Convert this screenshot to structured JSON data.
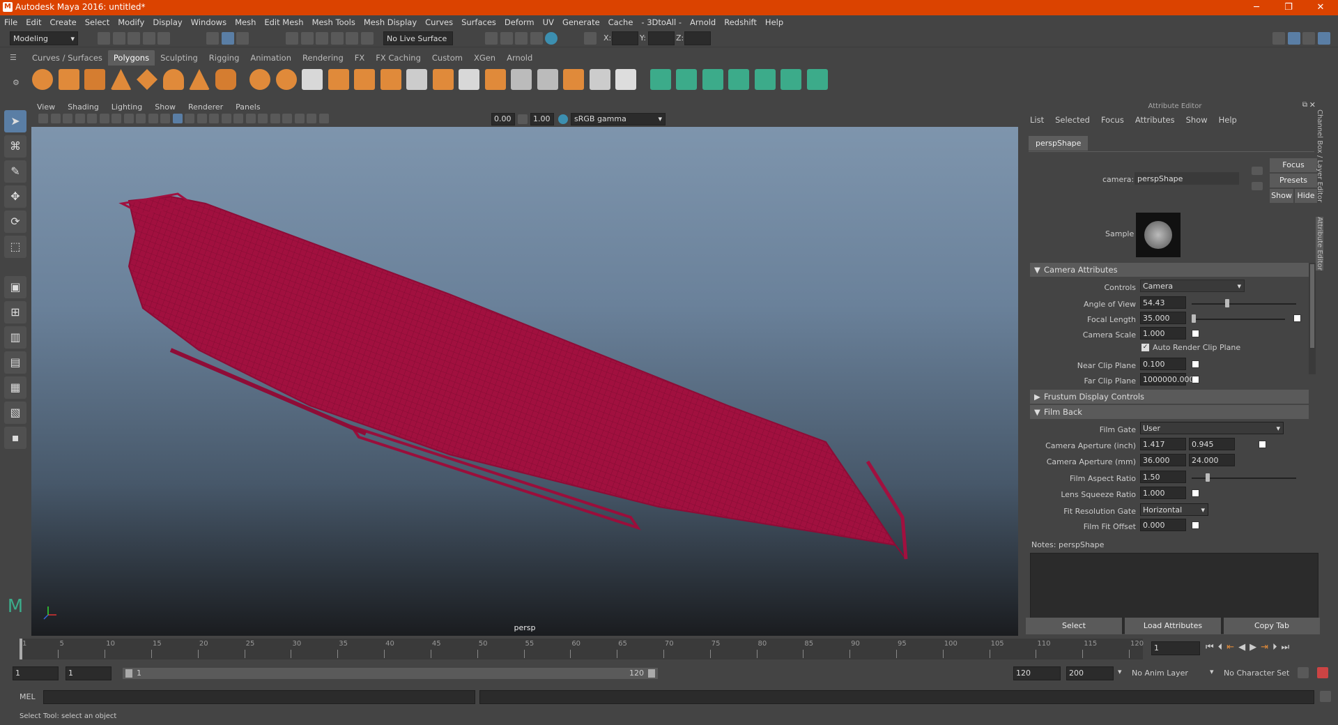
{
  "titlebar": {
    "title": "Autodesk Maya 2016: untitled*",
    "min": "─",
    "max": "❐",
    "close": "✕"
  },
  "menubar": [
    "File",
    "Edit",
    "Create",
    "Select",
    "Modify",
    "Display",
    "Windows",
    "Mesh",
    "Edit Mesh",
    "Mesh Tools",
    "Mesh Display",
    "Curves",
    "Surfaces",
    "Deform",
    "UV",
    "Generate",
    "Cache",
    "- 3DtoAll -",
    "Arnold",
    "Redshift",
    "Help"
  ],
  "statusline": {
    "menuset": "Modeling",
    "live_surface": "No Live Surface",
    "x_label": "X:",
    "y_label": "Y:",
    "z_label": "Z:"
  },
  "shelf_tabs": [
    "Curves / Surfaces",
    "Polygons",
    "Sculpting",
    "Rigging",
    "Animation",
    "Rendering",
    "FX",
    "FX Caching",
    "Custom",
    "XGen",
    "Arnold"
  ],
  "shelf_active": "Polygons",
  "panel_menu": [
    "View",
    "Shading",
    "Lighting",
    "Show",
    "Renderer",
    "Panels"
  ],
  "panel_tools": {
    "near_value": "0.00",
    "far_value": "1.00",
    "color_space": "sRGB gamma"
  },
  "viewport": {
    "camera_label": "persp"
  },
  "attribute_editor": {
    "title": "Attribute Editor",
    "menu": [
      "List",
      "Selected",
      "Focus",
      "Attributes",
      "Show",
      "Help"
    ],
    "tab": "perspShape",
    "camera_label": "camera:",
    "camera_value": "perspShape",
    "focus_btn": "Focus",
    "presets_btn": "Presets",
    "show_btn": "Show",
    "hide_btn": "Hide",
    "sample_label": "Sample",
    "sections": {
      "camera_attributes": "Camera Attributes",
      "frustum": "Frustum Display Controls",
      "film_back": "Film Back"
    },
    "controls_label": "Controls",
    "controls_value": "Camera",
    "angle_label": "Angle of View",
    "angle_value": "54.43",
    "focal_label": "Focal Length",
    "focal_value": "35.000",
    "scale_label": "Camera Scale",
    "scale_value": "1.000",
    "auto_clip_label": "Auto Render Clip Plane",
    "near_label": "Near Clip Plane",
    "near_value": "0.100",
    "far_label": "Far Clip Plane",
    "far_value": "1000000.000",
    "film_gate_label": "Film Gate",
    "film_gate_value": "User",
    "aperture_inch_label": "Camera Aperture (inch)",
    "aperture_inch_x": "1.417",
    "aperture_inch_y": "0.945",
    "aperture_mm_label": "Camera Aperture (mm)",
    "aperture_mm_x": "36.000",
    "aperture_mm_y": "24.000",
    "aspect_label": "Film Aspect Ratio",
    "aspect_value": "1.50",
    "squeeze_label": "Lens Squeeze Ratio",
    "squeeze_value": "1.000",
    "fit_gate_label": "Fit Resolution Gate",
    "fit_gate_value": "Horizontal",
    "fit_offset_label": "Film Fit Offset",
    "fit_offset_value": "0.000",
    "notes_label": "Notes:  perspShape",
    "select_btn": "Select",
    "load_btn": "Load Attributes",
    "copy_btn": "Copy Tab",
    "side_tabs": [
      "Channel Box / Layer Editor",
      "Attribute Editor"
    ]
  },
  "timeline": {
    "ticks": [
      "1",
      "5",
      "10",
      "15",
      "20",
      "25",
      "30",
      "35",
      "40",
      "45",
      "50",
      "55",
      "60",
      "65",
      "70",
      "75",
      "80",
      "85",
      "90",
      "95",
      "100",
      "105",
      "110",
      "115",
      "120"
    ],
    "current_frame": "1"
  },
  "range": {
    "start": "1",
    "anim_start": "1",
    "range_start": "1",
    "range_end": "120",
    "end": "120",
    "anim_end": "200",
    "anim_layer": "No Anim Layer",
    "char_set": "No Character Set"
  },
  "cmdline": {
    "label": "MEL"
  },
  "helpline": {
    "text": "Select Tool: select an object"
  }
}
